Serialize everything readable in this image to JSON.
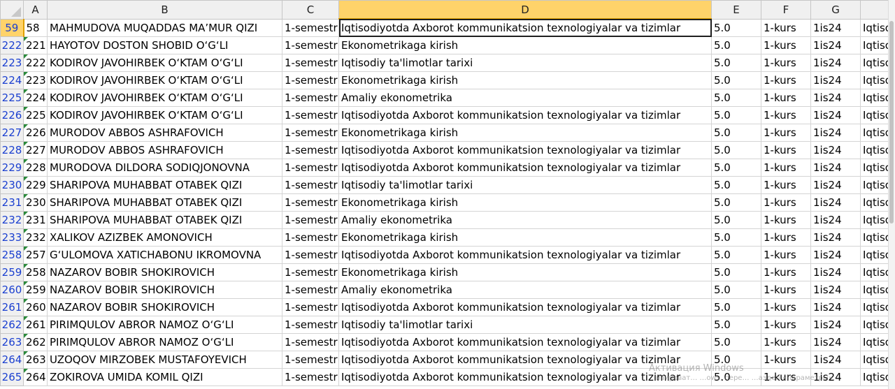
{
  "columns": {
    "A": "A",
    "B": "B",
    "C": "C",
    "D": "D",
    "E": "E",
    "F": "F",
    "G": "G"
  },
  "selected_column": "D",
  "active_row_header": "59",
  "rows": [
    {
      "rowhdr": "59",
      "a": "58",
      "b": "MAHMUDOVA MUQADDAS MAʼMUR QIZI",
      "c": "1-semestr",
      "d": "Iqtisodiyotda Axborot kommunikatsion texnologiyalar va tizimlar",
      "e": "5.0",
      "f": "1-kurs",
      "g": "1is24",
      "h": "Iqtiso"
    },
    {
      "rowhdr": "222",
      "a": "221",
      "b": "HAYOTOV DOSTON SHOBID O‘G‘LI",
      "c": "1-semestr",
      "d": "Ekonometrikaga kirish",
      "e": "5.0",
      "f": "1-kurs",
      "g": "1is24",
      "h": "Iqtiso"
    },
    {
      "rowhdr": "223",
      "a": "222",
      "b": "KODIROV JAVOHIRBEK O‘KTAM O‘G‘LI",
      "c": "1-semestr",
      "d": "Iqtisodiy ta'limotlar tarixi",
      "e": "5.0",
      "f": "1-kurs",
      "g": "1is24",
      "h": "Iqtiso"
    },
    {
      "rowhdr": "224",
      "a": "223",
      "b": "KODIROV JAVOHIRBEK O‘KTAM O‘G‘LI",
      "c": "1-semestr",
      "d": "Ekonometrikaga kirish",
      "e": "5.0",
      "f": "1-kurs",
      "g": "1is24",
      "h": "Iqtiso"
    },
    {
      "rowhdr": "225",
      "a": "224",
      "b": "KODIROV JAVOHIRBEK O‘KTAM O‘G‘LI",
      "c": "1-semestr",
      "d": "Amaliy ekonometrika",
      "e": "5.0",
      "f": "1-kurs",
      "g": "1is24",
      "h": "Iqtiso"
    },
    {
      "rowhdr": "226",
      "a": "225",
      "b": "KODIROV JAVOHIRBEK O‘KTAM O‘G‘LI",
      "c": "1-semestr",
      "d": "Iqtisodiyotda Axborot kommunikatsion texnologiyalar va tizimlar",
      "e": "5.0",
      "f": "1-kurs",
      "g": "1is24",
      "h": "Iqtiso"
    },
    {
      "rowhdr": "227",
      "a": "226",
      "b": "MURODOV ABBOS ASHRAFOVICH",
      "c": "1-semestr",
      "d": "Ekonometrikaga kirish",
      "e": "5.0",
      "f": "1-kurs",
      "g": "1is24",
      "h": "Iqtiso"
    },
    {
      "rowhdr": "228",
      "a": "227",
      "b": "MURODOV ABBOS ASHRAFOVICH",
      "c": "1-semestr",
      "d": "Iqtisodiyotda Axborot kommunikatsion texnologiyalar va tizimlar",
      "e": "5.0",
      "f": "1-kurs",
      "g": "1is24",
      "h": "Iqtiso"
    },
    {
      "rowhdr": "229",
      "a": "228",
      "b": "MURODOVA DILDORA SODIQJONOVNA",
      "c": "1-semestr",
      "d": "Iqtisodiyotda Axborot kommunikatsion texnologiyalar va tizimlar",
      "e": "5.0",
      "f": "1-kurs",
      "g": "1is24",
      "h": "Iqtiso"
    },
    {
      "rowhdr": "230",
      "a": "229",
      "b": "SHARIPOVA MUHABBAT OTABEK QIZI",
      "c": "1-semestr",
      "d": "Iqtisodiy ta'limotlar tarixi",
      "e": "5.0",
      "f": "1-kurs",
      "g": "1is24",
      "h": "Iqtiso"
    },
    {
      "rowhdr": "231",
      "a": "230",
      "b": "SHARIPOVA MUHABBAT OTABEK QIZI",
      "c": "1-semestr",
      "d": "Ekonometrikaga kirish",
      "e": "5.0",
      "f": "1-kurs",
      "g": "1is24",
      "h": "Iqtiso"
    },
    {
      "rowhdr": "232",
      "a": "231",
      "b": "SHARIPOVA MUHABBAT OTABEK QIZI",
      "c": "1-semestr",
      "d": "Amaliy ekonometrika",
      "e": "5.0",
      "f": "1-kurs",
      "g": "1is24",
      "h": "Iqtiso"
    },
    {
      "rowhdr": "233",
      "a": "232",
      "b": "XALIKOV AZIZBEK AMONOVICH",
      "c": "1-semestr",
      "d": "Ekonometrikaga kirish",
      "e": "5.0",
      "f": "1-kurs",
      "g": "1is24",
      "h": "Iqtiso"
    },
    {
      "rowhdr": "258",
      "a": "257",
      "b": "G‘ULOMOVA XATICHABONU IKROMOVNA",
      "c": "1-semestr",
      "d": "Iqtisodiyotda Axborot kommunikatsion texnologiyalar va tizimlar",
      "e": "5.0",
      "f": "1-kurs",
      "g": "1is24",
      "h": "Iqtiso"
    },
    {
      "rowhdr": "259",
      "a": "258",
      "b": "NAZAROV BOBIR SHOKIROVICH",
      "c": "1-semestr",
      "d": "Ekonometrikaga kirish",
      "e": "5.0",
      "f": "1-kurs",
      "g": "1is24",
      "h": "Iqtiso"
    },
    {
      "rowhdr": "260",
      "a": "259",
      "b": "NAZAROV BOBIR SHOKIROVICH",
      "c": "1-semestr",
      "d": "Amaliy ekonometrika",
      "e": "5.0",
      "f": "1-kurs",
      "g": "1is24",
      "h": "Iqtiso"
    },
    {
      "rowhdr": "261",
      "a": "260",
      "b": "NAZAROV BOBIR SHOKIROVICH",
      "c": "1-semestr",
      "d": "Iqtisodiyotda Axborot kommunikatsion texnologiyalar va tizimlar",
      "e": "5.0",
      "f": "1-kurs",
      "g": "1is24",
      "h": "Iqtiso"
    },
    {
      "rowhdr": "262",
      "a": "261",
      "b": "PIRIMQULOV ABROR NAMOZ O‘G‘LI",
      "c": "1-semestr",
      "d": "Iqtisodiy ta'limotlar tarixi",
      "e": "5.0",
      "f": "1-kurs",
      "g": "1is24",
      "h": "Iqtiso"
    },
    {
      "rowhdr": "263",
      "a": "262",
      "b": "PIRIMQULOV ABROR NAMOZ O‘G‘LI",
      "c": "1-semestr",
      "d": "Iqtisodiyotda Axborot kommunikatsion texnologiyalar va tizimlar",
      "e": "5.0",
      "f": "1-kurs",
      "g": "1is24",
      "h": "Iqtiso"
    },
    {
      "rowhdr": "264",
      "a": "263",
      "b": "UZOQOV MIRZOBEK MUSTAFOYEVICH",
      "c": "1-semestr",
      "d": "Iqtisodiyotda Axborot kommunikatsion texnologiyalar va tizimlar",
      "e": "5.0",
      "f": "1-kurs",
      "g": "1is24",
      "h": "Iqtiso"
    },
    {
      "rowhdr": "265",
      "a": "264",
      "b": "ZOKIROVA UMIDA KOMIL QIZI",
      "c": "1-semestr",
      "d": "Iqtisodiyotda Axborot kommunikatsion texnologiyalar va tizimlar",
      "e": "5.0",
      "f": "1-kurs",
      "g": "1is24",
      "h": "Iqtiso"
    }
  ],
  "watermark": {
    "line1": "Активация Windows",
    "line2": "…ивироват… …ows, пере… …аздел «Параметры»."
  },
  "colors": {
    "selection": "#ffd36a",
    "row_header_text": "#1a3fd0",
    "grid": "#d4d4d4"
  }
}
